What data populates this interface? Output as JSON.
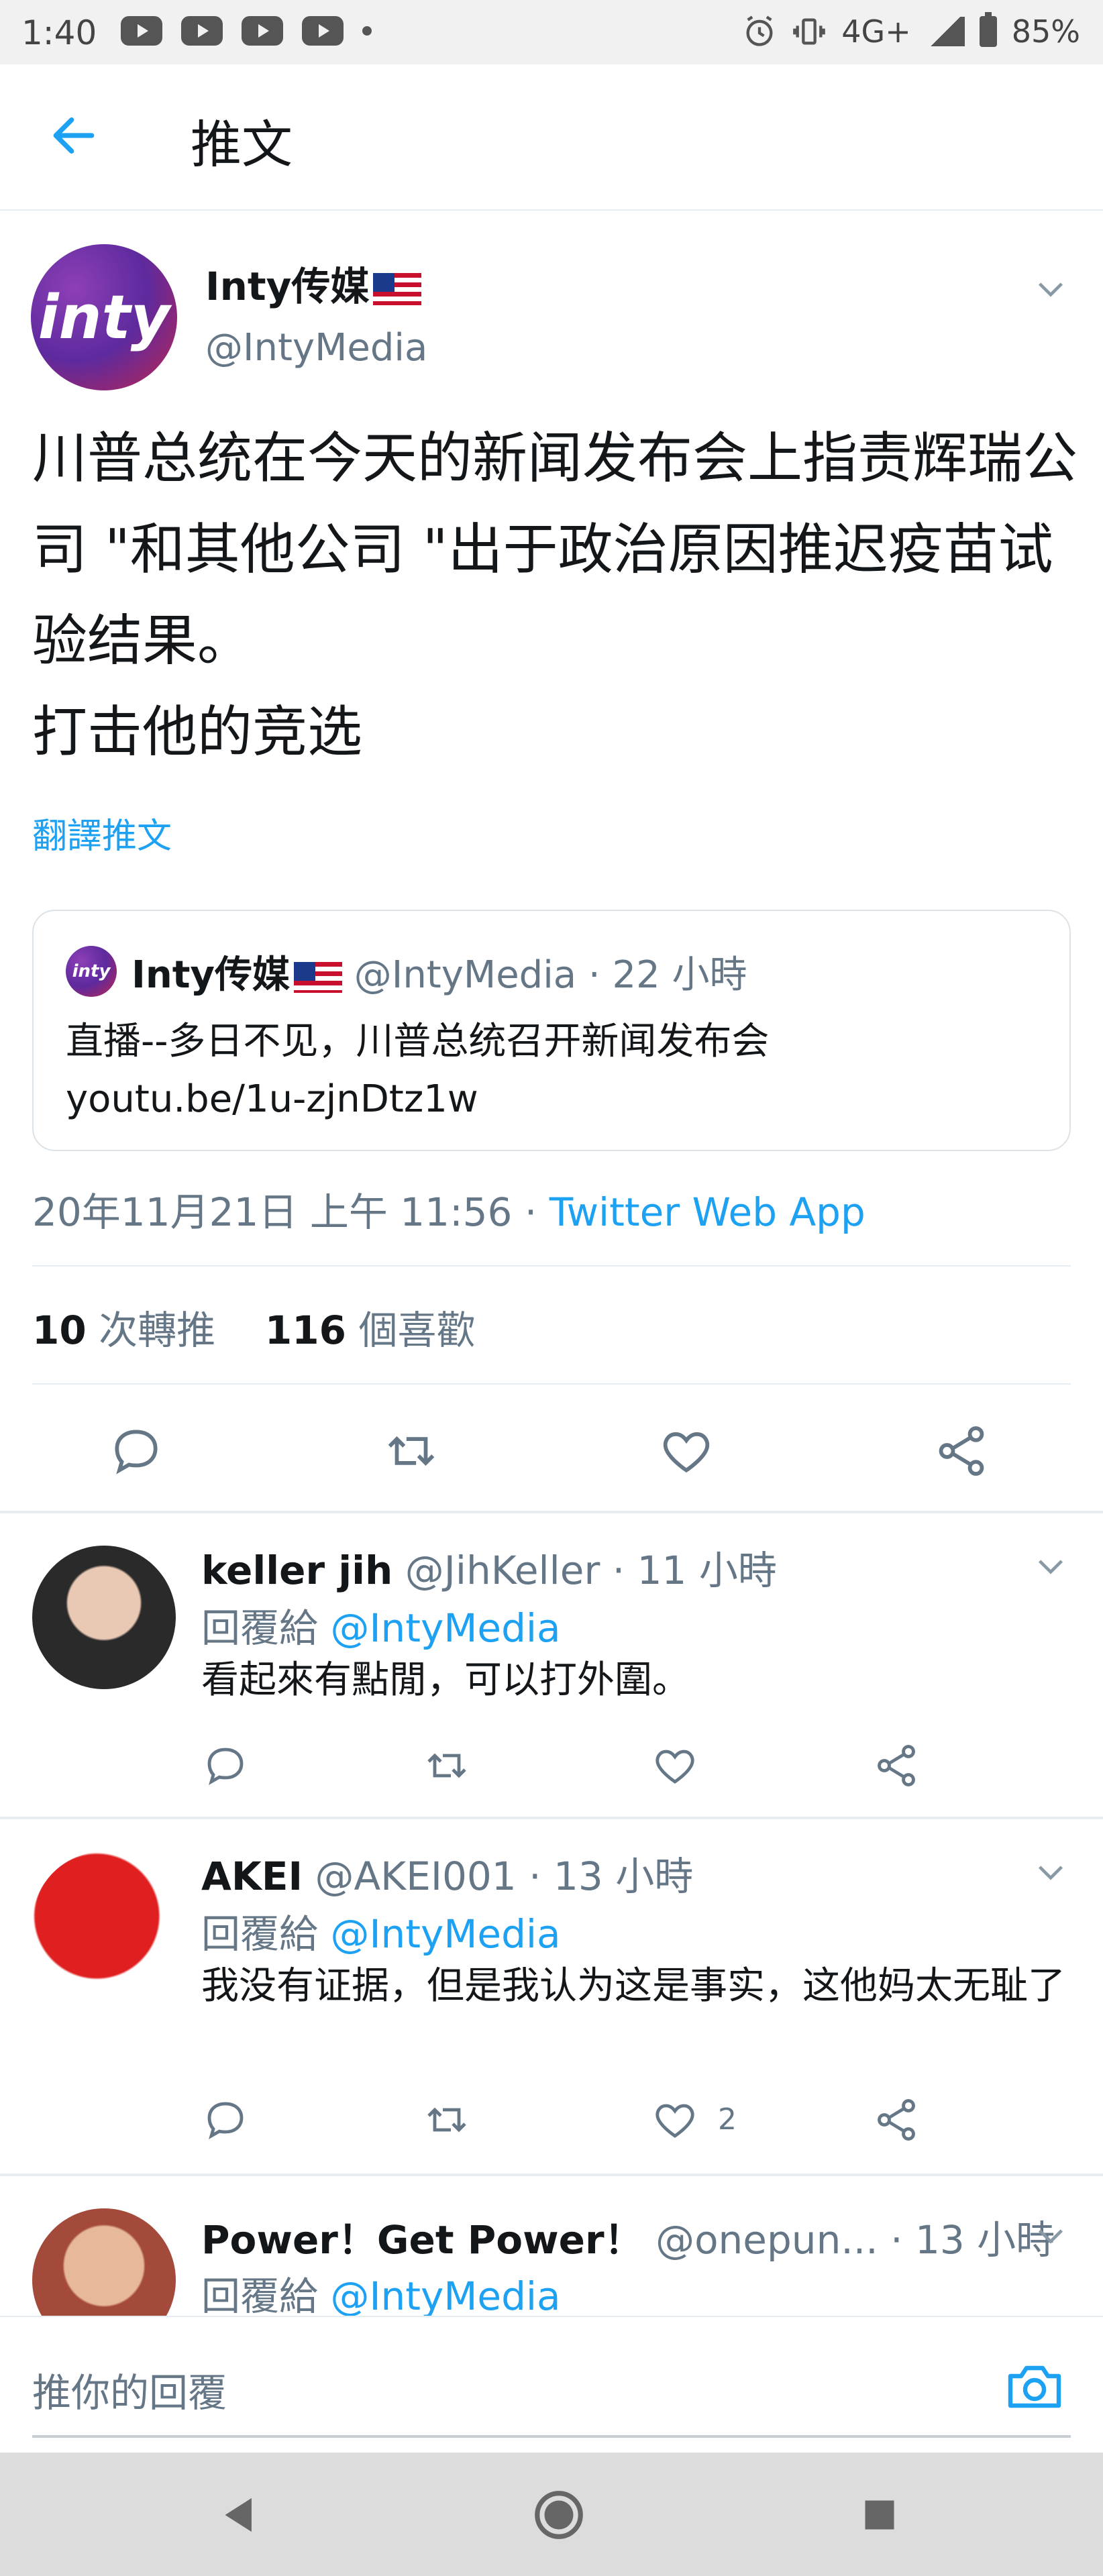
{
  "status_bar": {
    "time": "1:40",
    "network": "4G+",
    "battery": "85%",
    "icons": [
      "youtube-icon",
      "youtube-icon",
      "youtube-icon",
      "youtube-icon",
      "alarm-icon",
      "vibrate-icon",
      "signal-icon",
      "battery-icon"
    ]
  },
  "header": {
    "title": "推文"
  },
  "tweet": {
    "name": "Inty传媒",
    "handle": "@IntyMedia",
    "avatar_text": "inty",
    "text": "川普总统在今天的新闻发布会上指责辉瑞公司 \"和其他公司 \"出于政治原因推迟疫苗试验结果。\n打击他的竞选",
    "translate": "翻譯推文",
    "quote": {
      "avatar_text": "inty",
      "name": "Inty传媒",
      "handle": "@IntyMedia · 22 小時",
      "text": "直播--多日不见，川普总统召开新闻发布会\nyoutu.be/1u-zjnDtz1w"
    },
    "timestamp": "20年11月21日 上午 11:56 · ",
    "source_app": "Twitter Web App",
    "retweets_count": "10",
    "retweets_label": "次轉推",
    "likes_count": "116",
    "likes_label": "個喜歡"
  },
  "replies": [
    {
      "name": "keller jih",
      "handle": "@JihKeller · 11 小時",
      "reply_to_label": "回覆給 ",
      "reply_to": "@IntyMedia",
      "text": "看起來有點閒，可以打外圍。",
      "likes": ""
    },
    {
      "name": "AKEI",
      "handle": "@AKEI001 · 13 小時",
      "reply_to_label": "回覆給 ",
      "reply_to": "@IntyMedia",
      "text": "我没有证据，但是我认为这是事实，这他妈太无耻了",
      "likes": "2"
    },
    {
      "name": "Power！Get Power！",
      "handle": "@onepun... · 13 小時",
      "reply_to_label": "回覆給 ",
      "reply_to": "@IntyMedia",
      "text": "",
      "likes": ""
    }
  ],
  "compose": {
    "placeholder": "推你的回覆"
  },
  "colors": {
    "accent": "#1da1f2",
    "secondary_text": "#657786",
    "primary_text": "#14171a",
    "divider": "#e6ecf0"
  }
}
